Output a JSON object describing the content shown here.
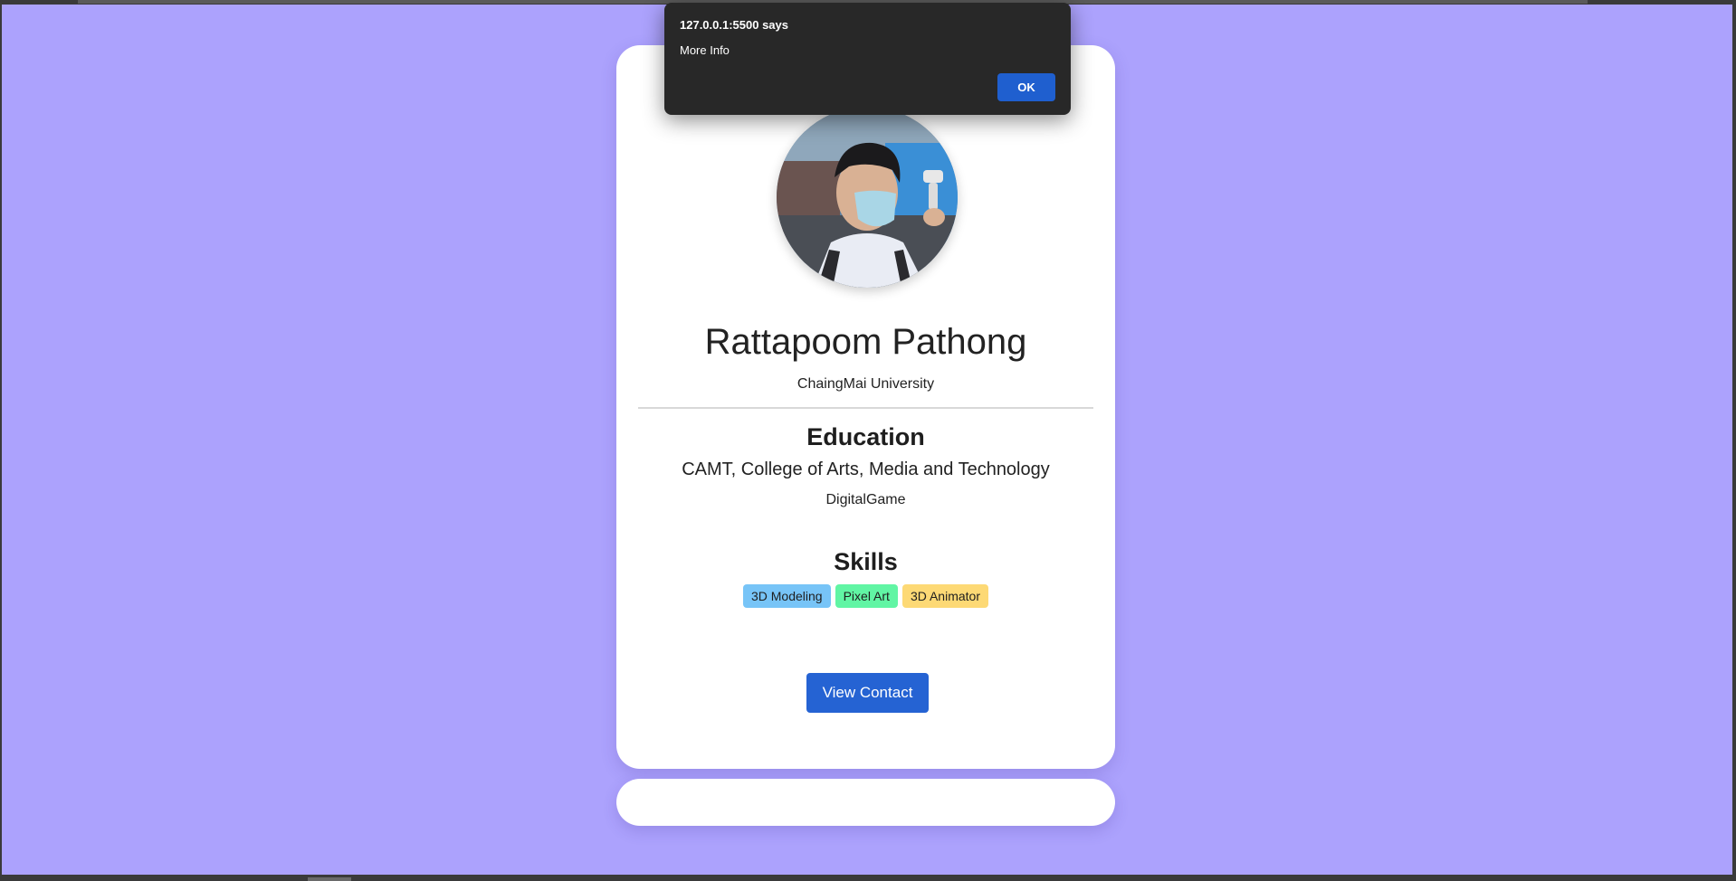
{
  "profile": {
    "name": "Rattapoom Pathong",
    "university": "ChaingMai University"
  },
  "education": {
    "title": "Education",
    "school": "CAMT, College of Arts, Media and Technology",
    "major": "DigitalGame"
  },
  "skills": {
    "title": "Skills",
    "items": [
      {
        "label": "3D Modeling",
        "color": "#77c4f7"
      },
      {
        "label": "Pixel Art",
        "color": "#61f5a4"
      },
      {
        "label": "3D Animator",
        "color": "#fdd975"
      }
    ]
  },
  "actions": {
    "view_contact_label": "View Contact"
  },
  "dialog": {
    "title": "127.0.0.1:5500 says",
    "message": "More Info",
    "ok_label": "OK"
  },
  "colors": {
    "background": "#aca2fd",
    "card": "#ffffff",
    "button": "#2563d3",
    "dialog": "#282828"
  },
  "icons": {
    "avatar": "profile-photo"
  }
}
